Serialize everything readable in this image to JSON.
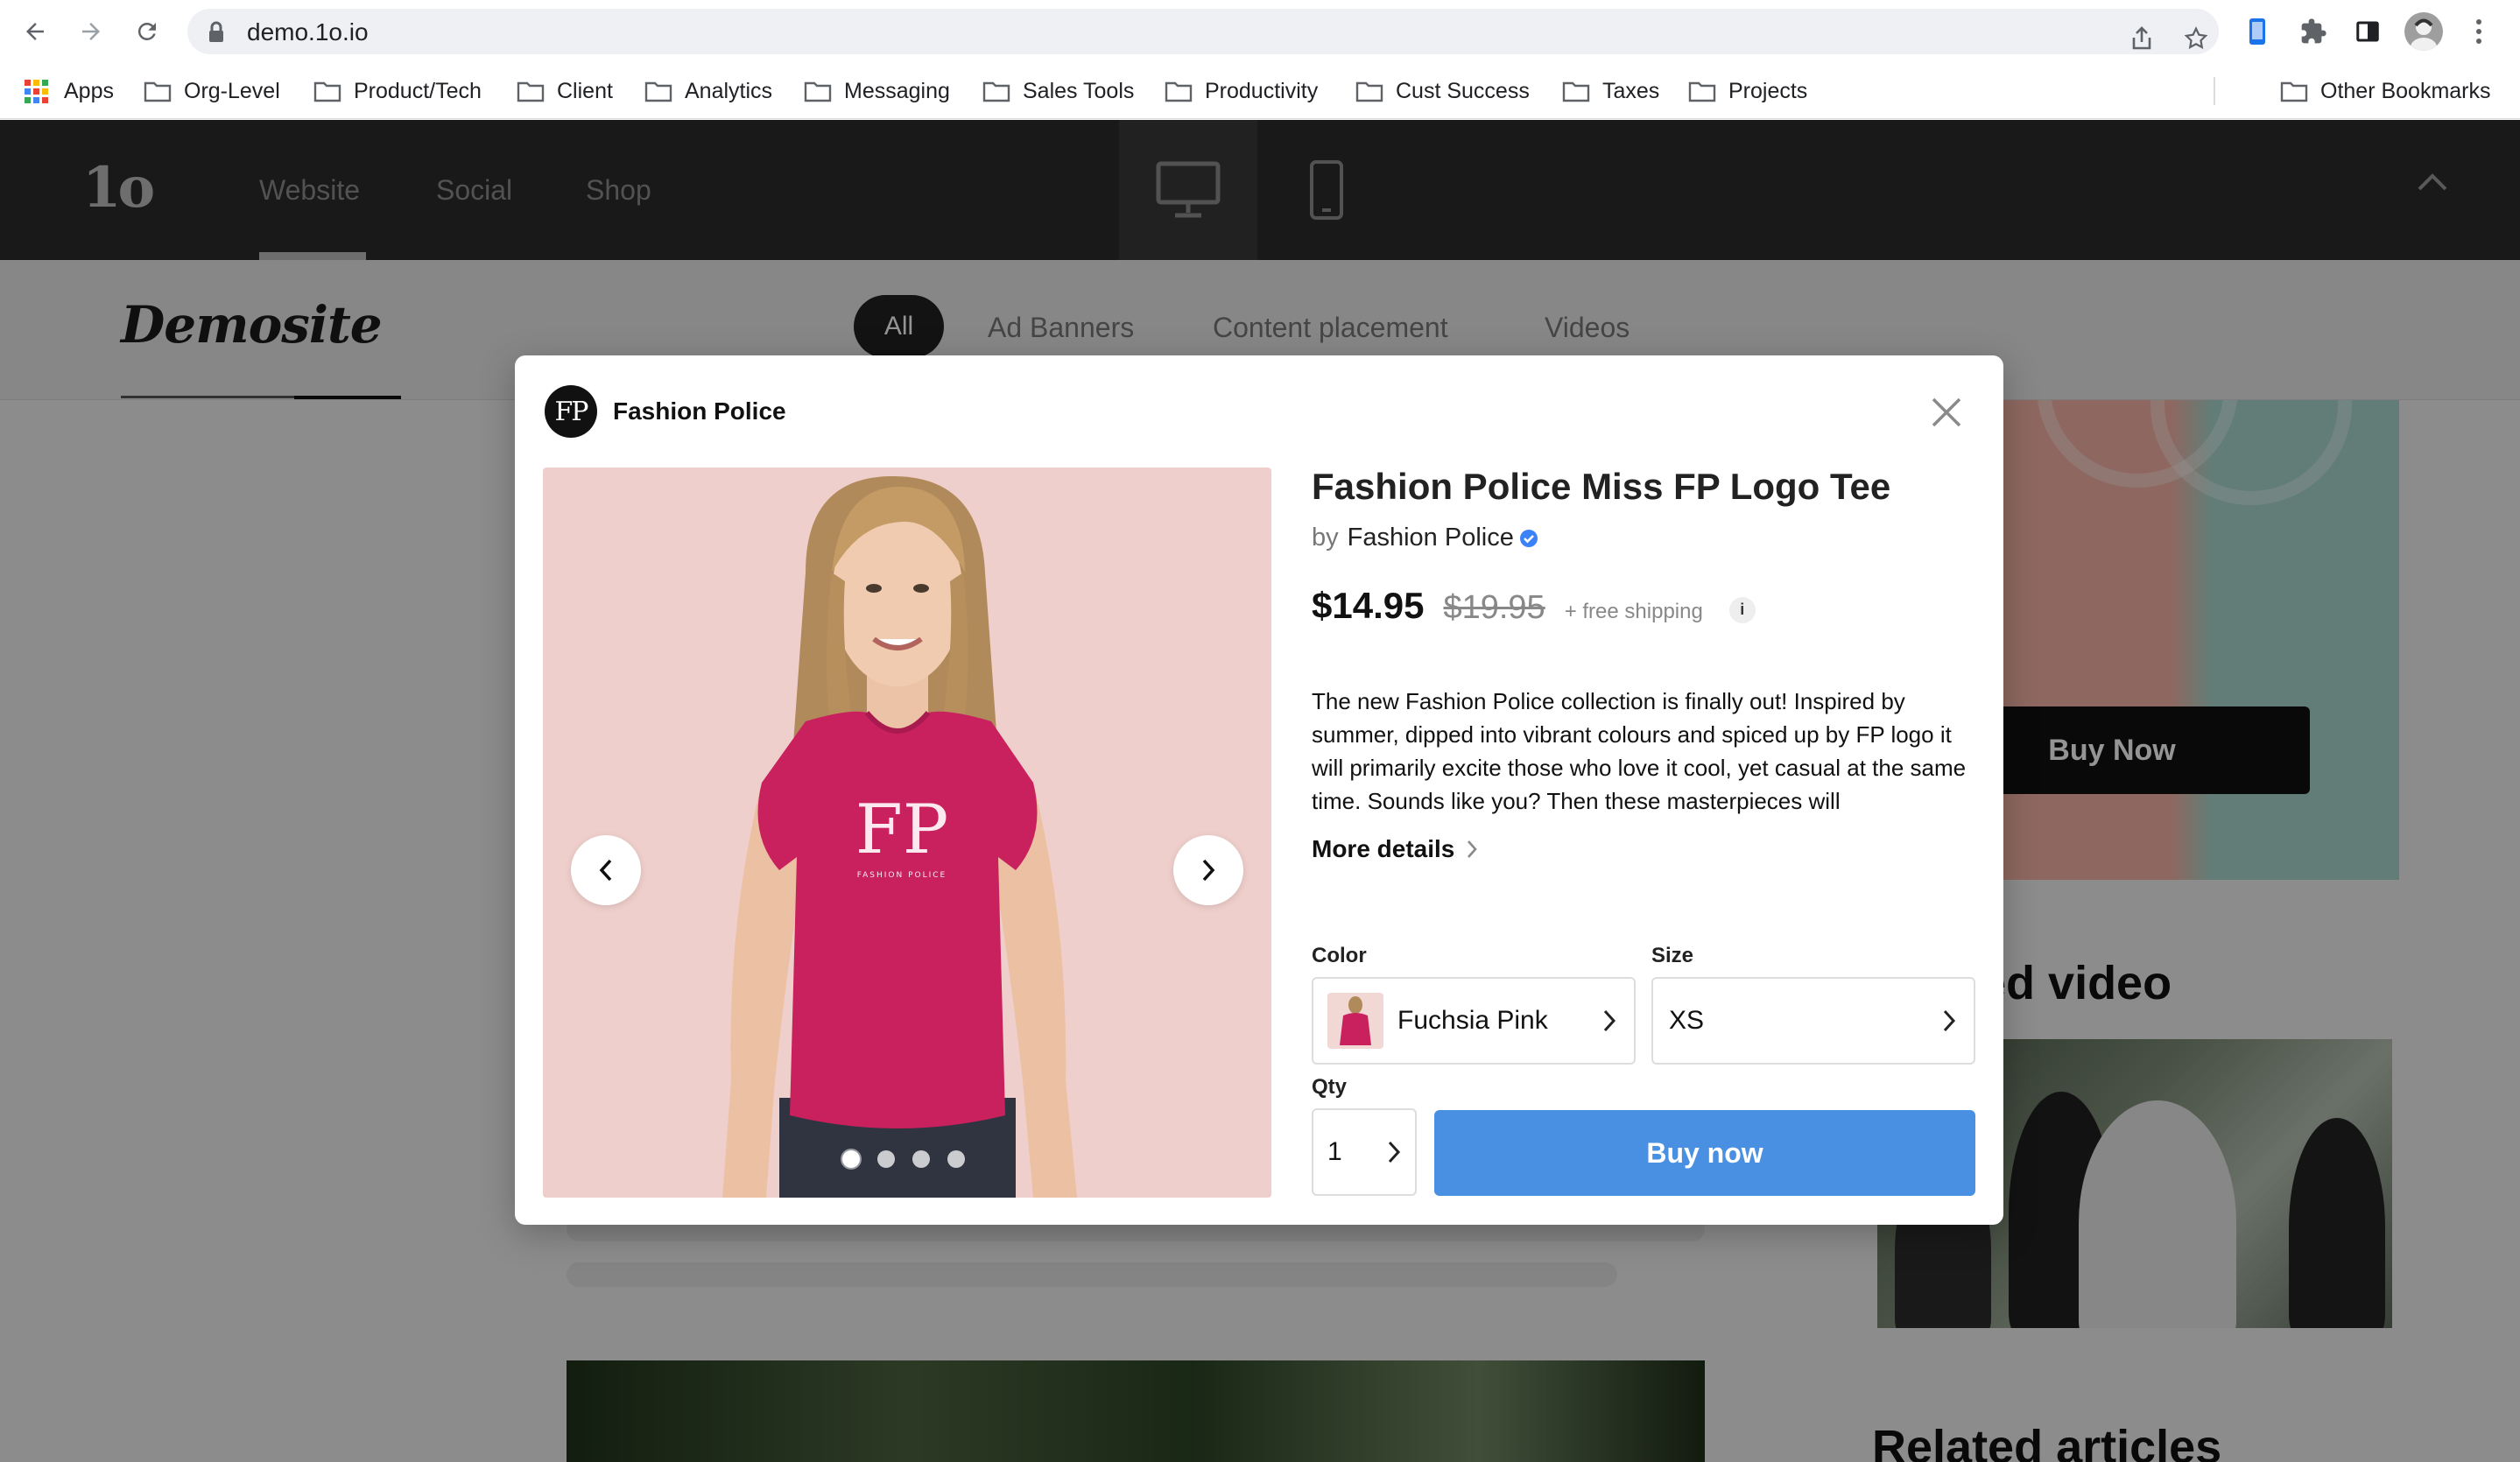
{
  "browser": {
    "url": "demo.1o.io",
    "bookmarks": [
      {
        "label": "Apps",
        "icon": "apps-grid-icon"
      },
      {
        "label": "Org-Level",
        "icon": "folder-icon"
      },
      {
        "label": "Product/Tech",
        "icon": "folder-icon"
      },
      {
        "label": "Client",
        "icon": "folder-icon"
      },
      {
        "label": "Analytics",
        "icon": "folder-icon"
      },
      {
        "label": "Messaging",
        "icon": "folder-icon"
      },
      {
        "label": "Sales Tools",
        "icon": "folder-icon"
      },
      {
        "label": "Productivity",
        "icon": "folder-icon"
      },
      {
        "label": "Cust Success",
        "icon": "folder-icon"
      },
      {
        "label": "Taxes",
        "icon": "folder-icon"
      },
      {
        "label": "Projects",
        "icon": "folder-icon"
      }
    ],
    "other_bookmarks": "Other Bookmarks"
  },
  "site_header": {
    "logo": "1o",
    "tabs": [
      "Website",
      "Social",
      "Shop"
    ],
    "active_tab": "Website"
  },
  "demo_bar": {
    "logo": "Demosite",
    "tabs": [
      "All",
      "Ad Banners",
      "Content placement",
      "Videos"
    ],
    "active_tab": "All"
  },
  "background": {
    "ad_button": "Buy Now",
    "featured_heading": "red video",
    "related_heading": "Related articles"
  },
  "modal": {
    "brand": {
      "logo_text": "FP",
      "name": "Fashion Police"
    },
    "product": {
      "title": "Fashion Police Miss FP Logo Tee",
      "by_label": "by",
      "brand": "Fashion Police",
      "price": "$14.95",
      "old_price": "$19.95",
      "shipping": "+ free shipping",
      "info_icon": "i",
      "description": "The new Fashion Police collection is finally out! Inspired by summer, dipped into vibrant colours and spiced up by FP logo it will primarily excite those who love it cool, yet casual at the same time. Sounds like you? Then these masterpieces will",
      "more_details": "More details",
      "shirt_print": "FP",
      "shirt_subprint": "FASHION POLICE"
    },
    "gallery": {
      "image_count": 4,
      "active_index": 0
    },
    "options": {
      "color_label": "Color",
      "color_value": "Fuchsia Pink",
      "size_label": "Size",
      "size_value": "XS",
      "qty_label": "Qty",
      "qty_value": "1"
    },
    "buy_button": "Buy now"
  },
  "colors": {
    "header_dark": "#2b2b2b",
    "buy_blue": "#4a90e2",
    "shirt_fuchsia": "#c8215e",
    "gallery_bg": "#efcfcb"
  }
}
